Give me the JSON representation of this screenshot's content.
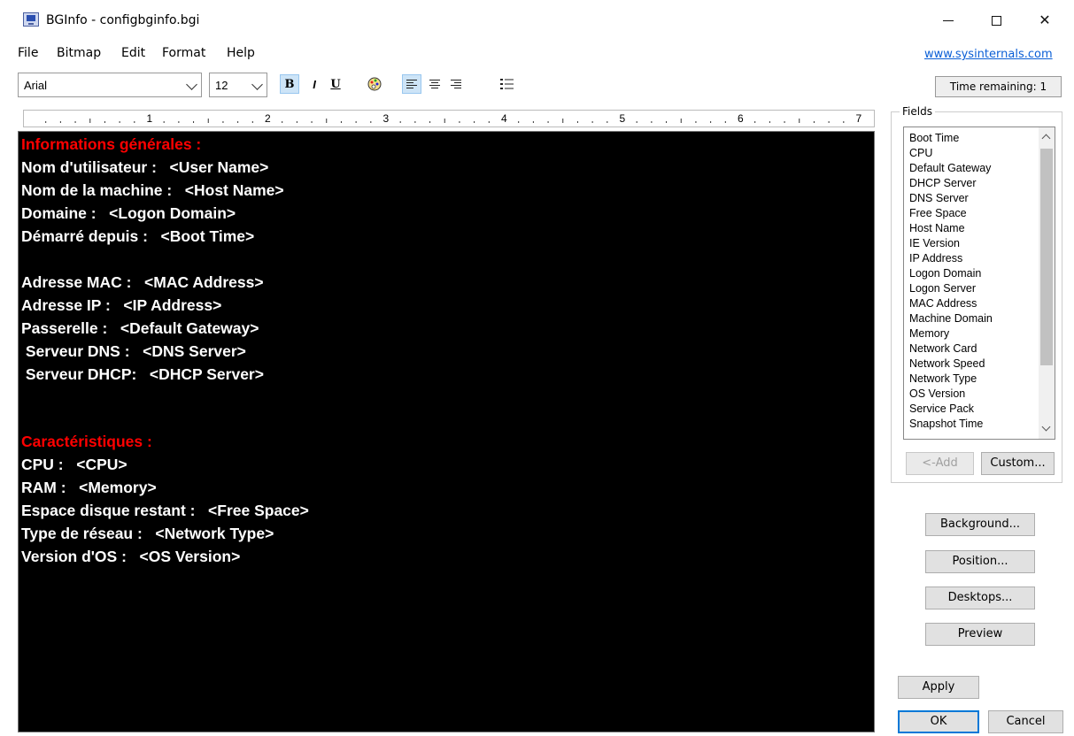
{
  "window": {
    "title": "BGInfo - configbginfo.bgi",
    "icon": "bginfo-monitor-icon"
  },
  "menu": {
    "items": [
      "File",
      "Bitmap",
      "Edit",
      "Format",
      "Help"
    ],
    "website": "www.sysinternals.com"
  },
  "toolbar": {
    "font": "Arial",
    "size": "12",
    "bold": "B",
    "italic": "I",
    "underline": "U",
    "time_remaining": "Time remaining: 1"
  },
  "ruler": {
    "numbers": [
      "1",
      "2",
      "3",
      "4",
      "5",
      "6",
      "7"
    ]
  },
  "editor": {
    "lines": [
      {
        "text": "Informations générales :",
        "color": "#ff0000"
      },
      {
        "text": "Nom d'utilisateur :   <User Name>",
        "color": "#ffffff"
      },
      {
        "text": "Nom de la machine :   <Host Name>",
        "color": "#ffffff"
      },
      {
        "text": "Domaine :   <Logon Domain>",
        "color": "#ffffff"
      },
      {
        "text": "Démarré depuis :   <Boot Time>",
        "color": "#ffffff"
      },
      {
        "text": "Adresse MAC :   <MAC Address>",
        "color": "#ffffff"
      },
      {
        "text": "Adresse IP :   <IP Address>",
        "color": "#ffffff"
      },
      {
        "text": "Passerelle :   <Default Gateway>",
        "color": "#ffffff"
      },
      {
        "text": " Serveur DNS :   <DNS Server>",
        "color": "#ffffff"
      },
      {
        "text": " Serveur DHCP:   <DHCP Server>",
        "color": "#ffffff"
      },
      {
        "text": "Caractéristiques :",
        "color": "#ff0000"
      },
      {
        "text": "CPU :   <CPU>",
        "color": "#ffffff"
      },
      {
        "text": "RAM :   <Memory>",
        "color": "#ffffff"
      },
      {
        "text": "Espace disque restant :   <Free Space>",
        "color": "#ffffff"
      },
      {
        "text": "Type de réseau :   <Network Type>",
        "color": "#ffffff"
      },
      {
        "text": "Version d'OS :   <OS Version>",
        "color": "#ffffff"
      }
    ]
  },
  "fields": {
    "caption": "Fields",
    "items": [
      "Boot Time",
      "CPU",
      "Default Gateway",
      "DHCP Server",
      "DNS Server",
      "Free Space",
      "Host Name",
      "IE Version",
      "IP Address",
      "Logon Domain",
      "Logon Server",
      "MAC Address",
      "Machine Domain",
      "Memory",
      "Network Card",
      "Network Speed",
      "Network Type",
      "OS Version",
      "Service Pack",
      "Snapshot Time"
    ],
    "add_label": "<-Add",
    "custom_label": "Custom..."
  },
  "buttons": {
    "background": "Background...",
    "position": "Position...",
    "desktops": "Desktops...",
    "preview": "Preview",
    "apply": "Apply",
    "ok": "OK",
    "cancel": "Cancel"
  },
  "colors": {
    "editor_bg": "#000000",
    "heading": "#ff0000",
    "text": "#ffffff",
    "link": "#0b5fd6",
    "default_button_border": "#0078d7"
  }
}
